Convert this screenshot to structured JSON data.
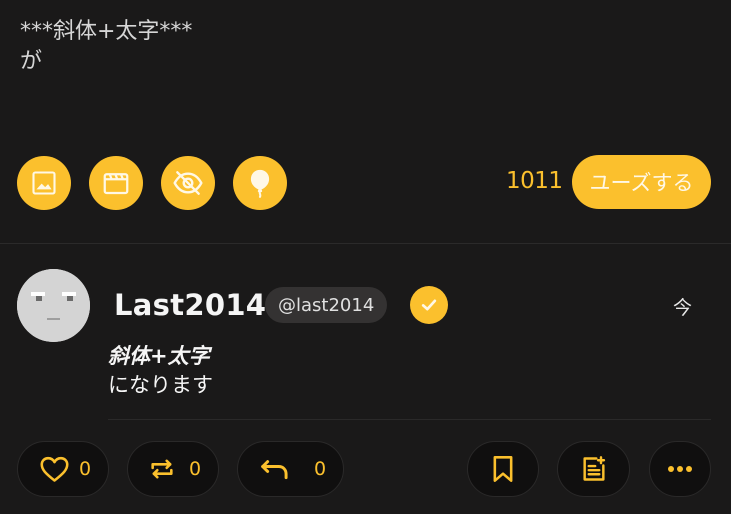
{
  "compose": {
    "text_line1": "***斜体+太字***",
    "text_line2": "が",
    "char_count": "1011",
    "post_label": "ユーズする",
    "tools": [
      "image-icon",
      "video-icon",
      "eye-off-icon",
      "balloon-icon"
    ]
  },
  "note": {
    "display_name": "Last2014",
    "username": "@last2014",
    "timestamp": "今",
    "body_em": "斜体+太字",
    "body_rest": "になります"
  },
  "actions": {
    "like_count": "0",
    "renote_count": "0",
    "reply_count": "0"
  },
  "colors": {
    "accent": "#fbc02d",
    "background": "#1a1919"
  }
}
